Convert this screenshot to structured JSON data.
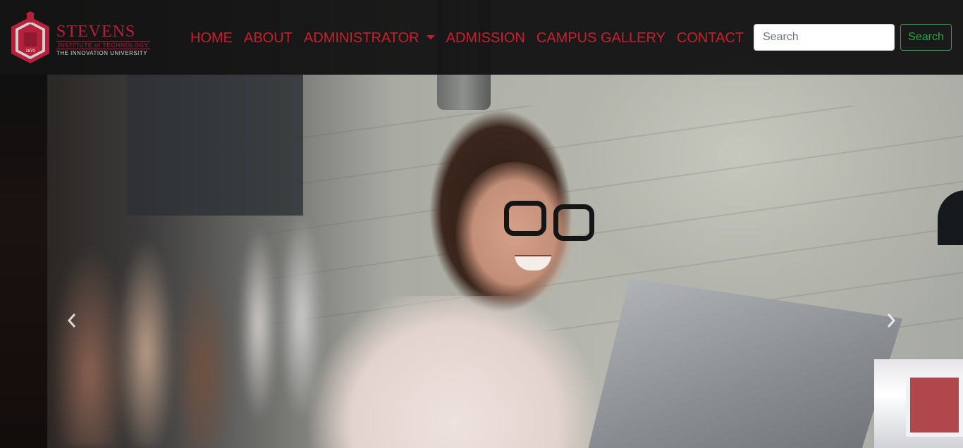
{
  "brand": {
    "name": "STEVENS",
    "subtitle": "INSTITUTE of TECHNOLOGY",
    "tagline": "THE INNOVATION UNIVERSITY",
    "shield_text": "1870",
    "logo_icon": "stevens-shield-logo",
    "color": "#b5203a"
  },
  "nav": {
    "link_color": "#c8202f",
    "items": [
      {
        "label": "HOME"
      },
      {
        "label": "ABOUT"
      },
      {
        "label": "ADMINISTRATOR",
        "dropdown": true,
        "icon": "caret-down-icon"
      },
      {
        "label": "ADMISSION"
      },
      {
        "label": "CAMPUS GALLERY"
      },
      {
        "label": "CONTACT"
      }
    ]
  },
  "search": {
    "placeholder": "Search",
    "value": "",
    "button_label": "Search",
    "button_color": "#28a745"
  },
  "carousel": {
    "prev_icon": "chevron-left-icon",
    "next_icon": "chevron-right-icon",
    "slide_image": "woman-with-glasses-smiling-at-laptop"
  }
}
